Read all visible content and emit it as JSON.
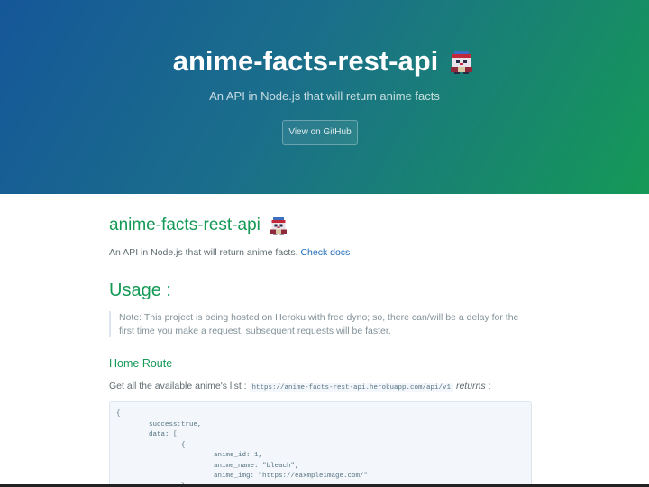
{
  "hero": {
    "title": "anime-facts-rest-api",
    "tagline": "An API in Node.js that will return anime facts",
    "github_button": "View on GitHub"
  },
  "content": {
    "title": "anime-facts-rest-api",
    "description": "An API in Node.js that will return anime facts.",
    "docs_link": "Check docs",
    "usage_heading": "Usage :",
    "note": "Note: This project is being hosted on Heroku with free dyno; so, there can/will be a delay for the first time you make a request, subsequent requests will be faster.",
    "home_route_heading": "Home Route",
    "home_route_desc": "Get all the available anime's list :",
    "home_route_url": "https://anime-facts-rest-api.herokuapp.com/api/v1",
    "returns_label": "returns",
    "returns_suffix": " :",
    "code_sample": "{\n        success:true,\n        data: [\n                {\n                        anime_id: 1,\n                        anime_name: \"bleach\",\n                        anime_img: \"https://eaxmpleimage.com/\"\n                },"
  },
  "icons": {
    "mascot": "anime-character-sprite-icon"
  },
  "colors": {
    "gradient_start": "#155799",
    "gradient_end": "#159957",
    "heading_green": "#159957",
    "link_blue": "#1e6bb8",
    "body_text": "#606c71"
  }
}
